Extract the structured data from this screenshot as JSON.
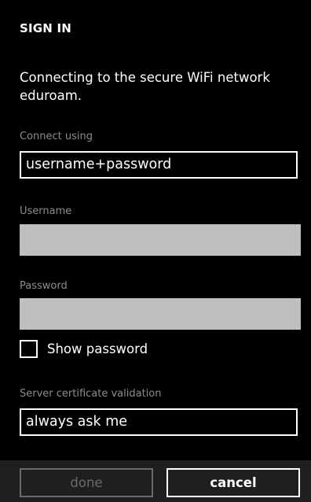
{
  "header": {
    "title": "SIGN IN"
  },
  "description": "Connecting to the secure WiFi network eduroam.",
  "connect_using": {
    "label": "Connect using",
    "value": "username+password"
  },
  "username": {
    "label": "Username",
    "value": ""
  },
  "password": {
    "label": "Password",
    "value": ""
  },
  "show_password": {
    "label": "Show password",
    "checked": false
  },
  "server_cert": {
    "label": "Server certificate validation",
    "value": "always ask me"
  },
  "app_bar": {
    "done_label": "done",
    "cancel_label": "cancel"
  },
  "colors": {
    "background": "#000000",
    "input_fill": "#bfbfbf",
    "label_gray": "#8c8c8c",
    "disabled_gray": "#6b6b6b",
    "app_bar": "#1f1f1f"
  }
}
